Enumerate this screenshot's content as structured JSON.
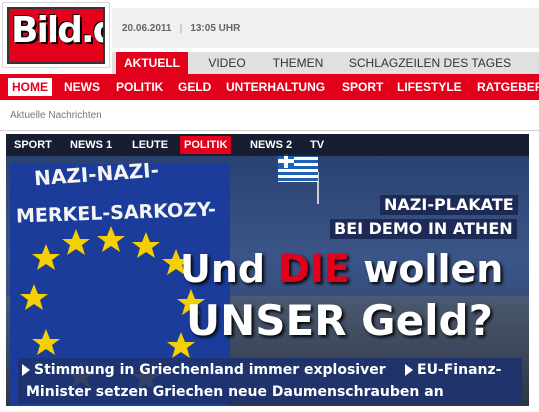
{
  "header": {
    "logo_text": "Bild.de",
    "date": "20.06.2011",
    "time": "13:05 UHR"
  },
  "main_tabs": [
    "AKTUELL",
    "VIDEO",
    "THEMEN",
    "SCHLAGZEILEN DES TAGES"
  ],
  "nav": [
    "HOME",
    "NEWS",
    "POLITIK",
    "GELD",
    "UNTERHALTUNG",
    "SPORT",
    "LIFESTYLE",
    "RATGEBER"
  ],
  "breadcrumb": "Aktuelle Nachrichten",
  "hero": {
    "categories": [
      "SPORT",
      "NEWS 1",
      "LEUTE",
      "POLITIK",
      "NEWS 2",
      "TV"
    ],
    "banner_text": [
      "NAZI-NAZI-",
      "MERKEL-SARKOZY-"
    ],
    "kicker": [
      "NAZI-PLAKATE",
      "BEI DEMO IN ATHEN"
    ],
    "headline_line1_pre": "Und ",
    "headline_line1_em": "DIE",
    "headline_line1_post": " wollen",
    "headline_line2": "UNSER Geld?",
    "teaser_1": "Stimmung in Griechenland immer explosiver",
    "teaser_2a": "EU-Finanz-",
    "teaser_2b": "Minister setzen Griechen neue Daumenschrauben an"
  },
  "colors": {
    "brand_red": "#e2001a",
    "navy": "#1c2a55"
  }
}
